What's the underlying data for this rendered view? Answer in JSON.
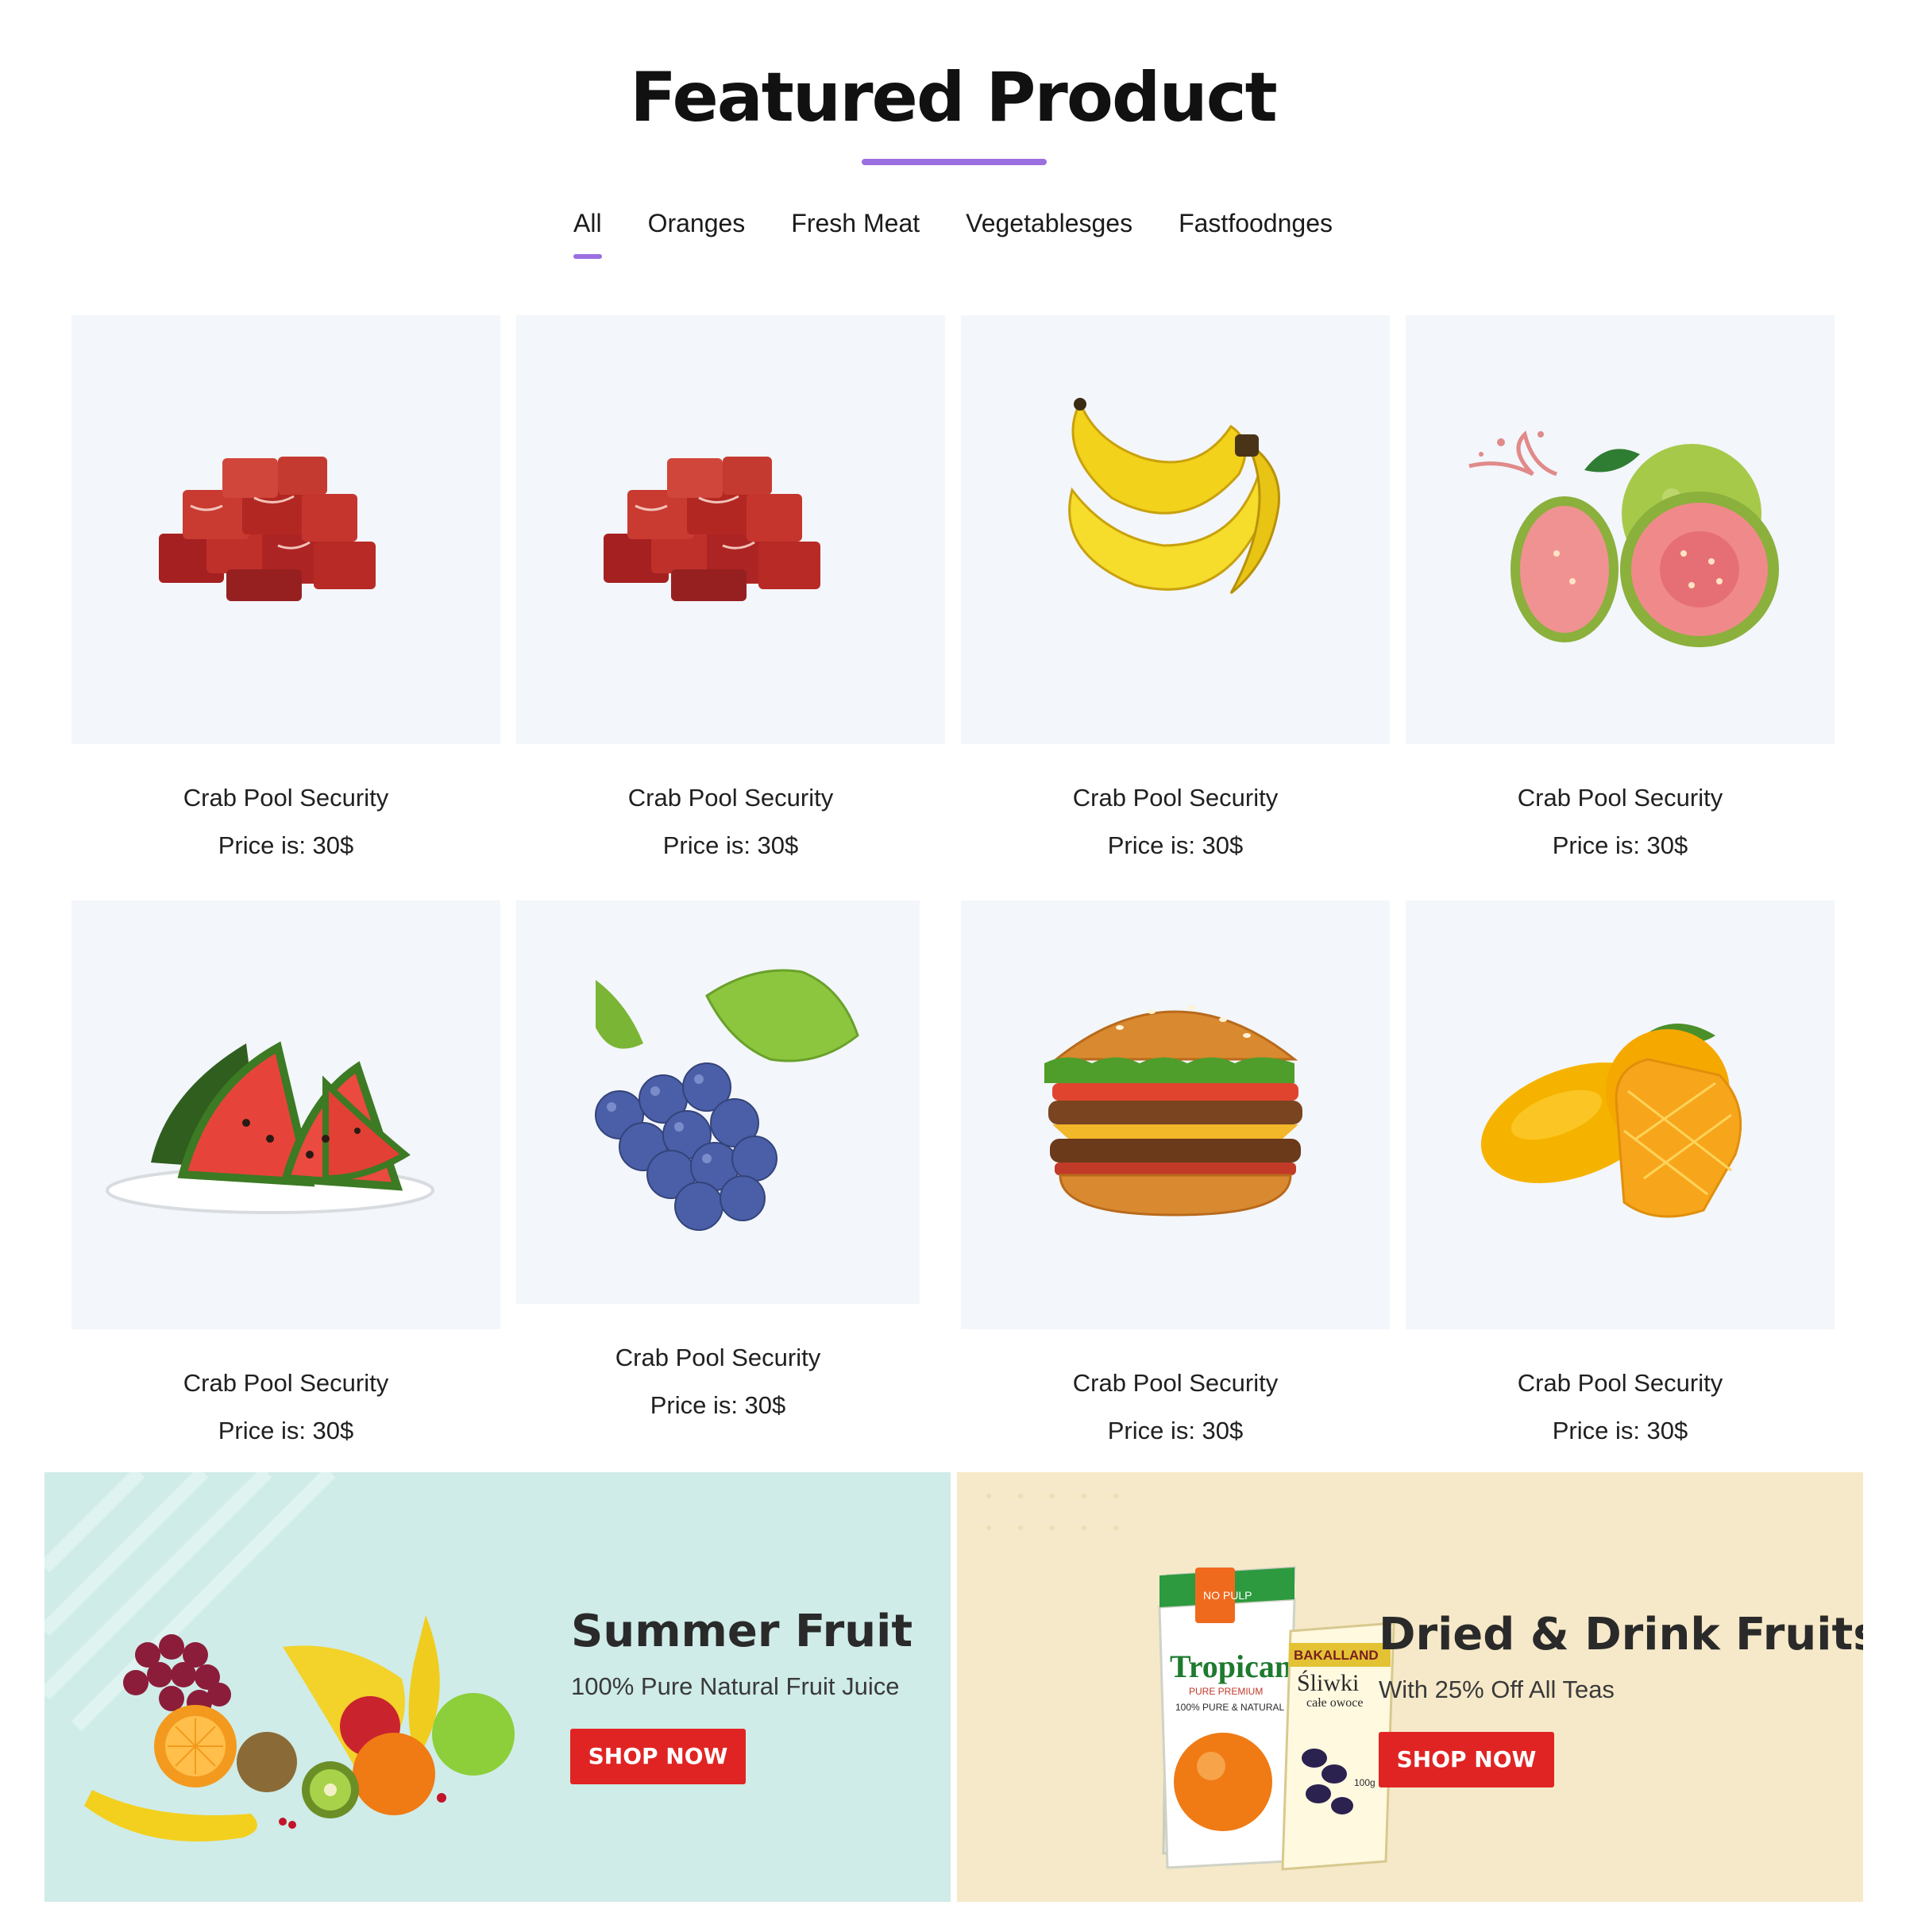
{
  "section": {
    "title": "Featured Product",
    "accent_color": "#9b6fe0"
  },
  "tabs": [
    {
      "label": "All",
      "active": true
    },
    {
      "label": "Oranges",
      "active": false
    },
    {
      "label": "Fresh Meat",
      "active": false
    },
    {
      "label": "Vegetablesges",
      "active": false
    },
    {
      "label": "Fastfoodnges",
      "active": false
    }
  ],
  "products": [
    {
      "name": "Crab Pool Security",
      "price": "Price is: 30$",
      "image": "meat-cubes-image"
    },
    {
      "name": "Crab Pool Security",
      "price": "Price is: 30$",
      "image": "meat-cubes-image"
    },
    {
      "name": "Crab Pool Security",
      "price": "Price is: 30$",
      "image": "banana-image"
    },
    {
      "name": "Crab Pool Security",
      "price": "Price is: 30$",
      "image": "guava-image"
    },
    {
      "name": "Crab Pool Security",
      "price": "Price is: 30$",
      "image": "watermelon-image"
    },
    {
      "name": "Crab Pool Security",
      "price": "Price is: 30$",
      "image": "grapes-image"
    },
    {
      "name": "Crab Pool Security",
      "price": "Price is: 30$",
      "image": "burger-image"
    },
    {
      "name": "Crab Pool Security",
      "price": "Price is: 30$",
      "image": "mango-image"
    }
  ],
  "banners": [
    {
      "title": "Summer Fruit",
      "subtitle": "100% Pure Natural Fruit Juice",
      "button": "SHOP NOW",
      "bg": "#cfece8"
    },
    {
      "title": "Dried & Drink Fruits",
      "subtitle": "With 25% Off All Teas",
      "button": "SHOP NOW",
      "bg": "#f6e9c9",
      "product_labels": {
        "carton_brand": "Tropicana",
        "carton_sub": "PURE PREMIUM",
        "carton_note": "100% PURE & NATURAL",
        "carton_badge": "NO PULP",
        "pouch_brand": "BAKALLAND",
        "pouch_name": "Śliwki",
        "pouch_sub": "całe owoce",
        "pouch_weight": "100g"
      }
    }
  ],
  "colors": {
    "card_bg": "#f3f6fa",
    "button_red": "#e02423"
  }
}
